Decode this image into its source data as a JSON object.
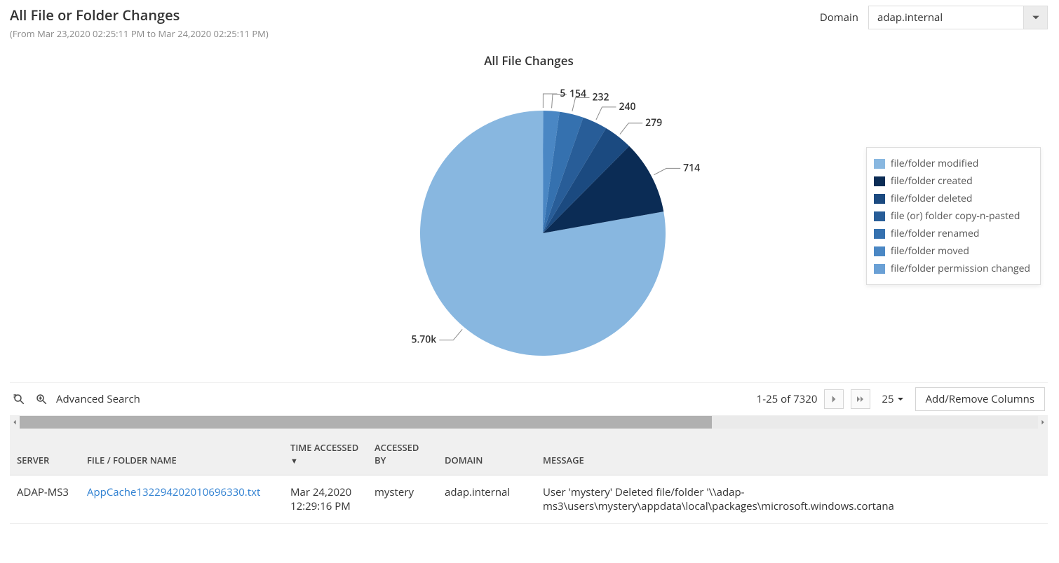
{
  "header": {
    "title": "All File or Folder Changes",
    "subtitle": "(From Mar 23,2020 02:25:11 PM to Mar 24,2020 02:25:11 PM)",
    "domain_label": "Domain",
    "domain_value": "adap.internal"
  },
  "chart_title": "All File Changes",
  "chart_data": {
    "type": "pie",
    "series": [
      {
        "name": "file/folder modified",
        "value": 5700,
        "label": "5.70k",
        "color": "#88b7e0"
      },
      {
        "name": "file/folder created",
        "value": 714,
        "label": "714",
        "color": "#0b2c55"
      },
      {
        "name": "file/folder deleted",
        "value": 279,
        "label": "279",
        "color": "#1b4a80"
      },
      {
        "name": "file (or) folder copy-n-pasted",
        "value": 240,
        "label": "240",
        "color": "#285d98"
      },
      {
        "name": "file/folder renamed",
        "value": 232,
        "label": "232",
        "color": "#3571af"
      },
      {
        "name": "file/folder moved",
        "value": 154,
        "label": "154",
        "color": "#4a87c4"
      },
      {
        "name": "file/folder permission changed",
        "value": 5,
        "label": "5",
        "color": "#6aa0d5"
      }
    ]
  },
  "toolbar": {
    "advanced_search": "Advanced Search",
    "range_text": "1-25 of 7320",
    "page_size": "25",
    "add_remove": "Add/Remove Columns"
  },
  "columns": {
    "server": "SERVER",
    "file": "FILE / FOLDER NAME",
    "time": "TIME ACCESSED",
    "by": "ACCESSED BY",
    "domain": "DOMAIN",
    "message": "MESSAGE"
  },
  "rows": [
    {
      "server": "ADAP-MS3",
      "file": "AppCache132294202010696330.txt",
      "time": "Mar 24,2020 12:29:16 PM",
      "by": "mystery",
      "domain": "adap.internal",
      "message": "User 'mystery' Deleted file/folder '\\\\adap-ms3\\users\\mystery\\appdata\\local\\packages\\microsoft.windows.cortana"
    }
  ]
}
